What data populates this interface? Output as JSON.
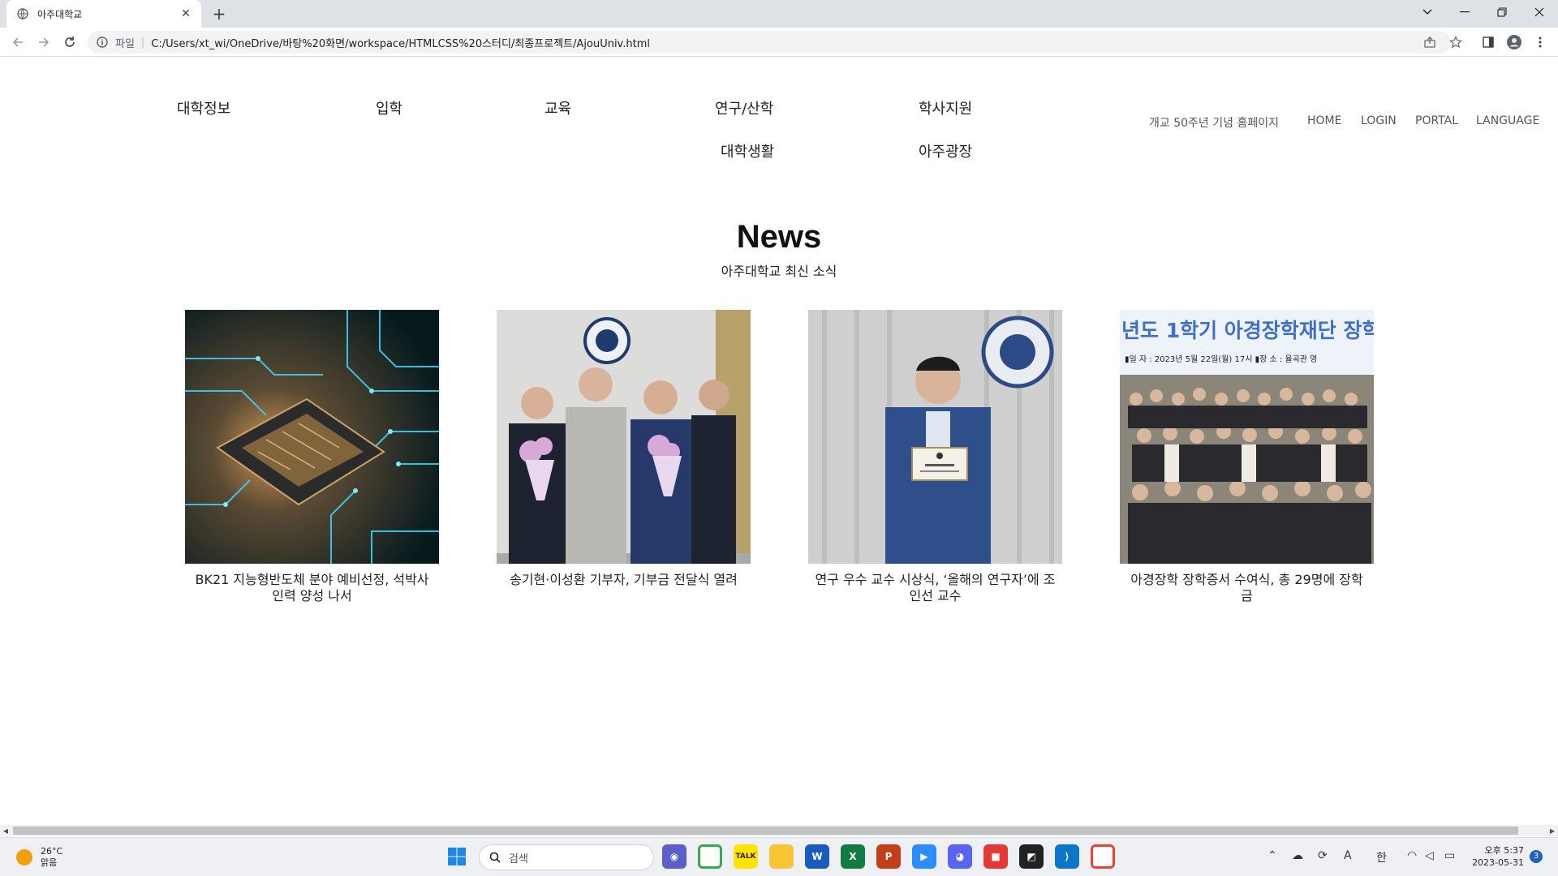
{
  "browser": {
    "tab_title": "아주대학교",
    "new_tab": "+",
    "address_protocol": "파일",
    "address_separator": "|",
    "address_url": "C:/Users/xt_wi/OneDrive/바탕%20화면/workspace/HTMLCSS%20스터디/최종프로젝트/AjouUniv.html"
  },
  "gnb": {
    "items": [
      "대학정보",
      "입학",
      "교육",
      "연구/산학",
      "학사지원",
      "대학생활",
      "아주광장"
    ]
  },
  "util_nav": {
    "items": [
      "개교 50주년 기념 홈페이지",
      "HOME",
      "LOGIN",
      "PORTAL",
      "LANGUAGE"
    ]
  },
  "news": {
    "title": "News",
    "subtitle": "아주대학교 최신 소식",
    "cards": [
      {
        "caption": "BK21 지능형반도체 분야 예비선정, 석박사 인력 양성 나서"
      },
      {
        "caption": "송기현·이성환 기부자, 기부금 전달식 열려"
      },
      {
        "caption": "연구 우수 교수 시상식, ‘올해의 연구자’에 조인선 교수"
      },
      {
        "caption": "아경장학 장학증서 수여식, 총 29명에 장학금"
      }
    ],
    "banner_text": {
      "headline": "년도 1학기 아경장학재단 장학",
      "details": "▮일 자 : 2023년 5월 22일(월) 17시   ▮장 소 : 율곡관 영"
    }
  },
  "taskbar": {
    "weather_temp": "26°C",
    "weather_desc": "맑음",
    "search_placeholder": "검색",
    "ime_lang": "한",
    "ime_mode": "A",
    "clock_time": "오후 5:37",
    "clock_date": "2023-05-31",
    "notification_count": "3"
  }
}
